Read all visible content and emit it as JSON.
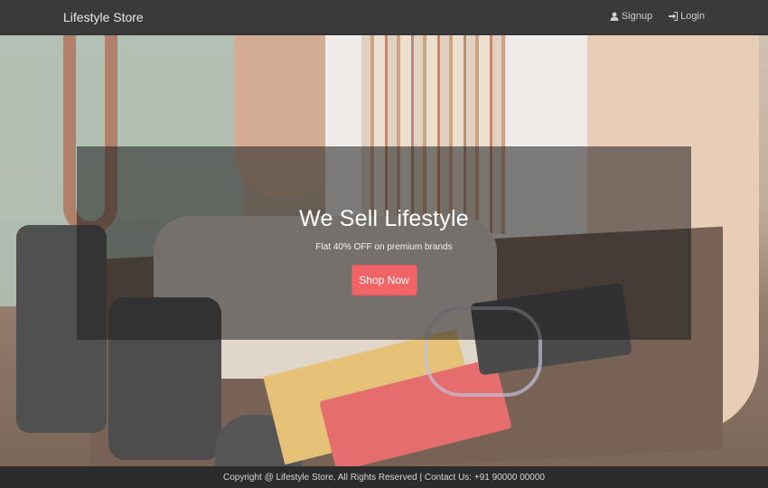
{
  "navbar": {
    "brand": "Lifestyle Store",
    "links": [
      {
        "label": "Signup",
        "icon": "user-icon"
      },
      {
        "label": "Login",
        "icon": "login-icon"
      }
    ]
  },
  "banner": {
    "title": "We Sell Lifestyle",
    "subtitle": "Flat 40% OFF on premium brands",
    "button_label": "Shop Now"
  },
  "footer": {
    "text": "Copyright @ Lifestyle Store. All Rights Reserved | Contact Us: +91 90000 00000"
  },
  "colors": {
    "navbar": "#3a3a3a",
    "button": "#f06466",
    "footer": "#2c2c2c"
  }
}
